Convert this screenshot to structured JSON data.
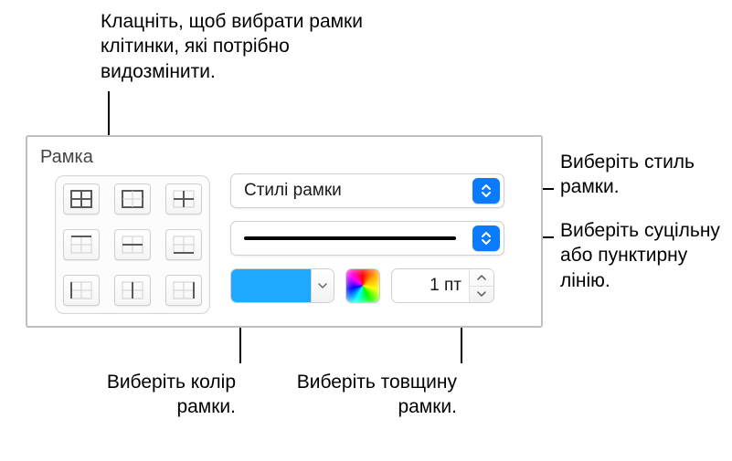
{
  "callouts": {
    "top": "Клацніть, щоб вибрати рамки клітинки, які потрібно видозмінити.",
    "style_right": "Виберіть стиль рамки.",
    "line_right": "Виберіть суцільну або пунктирну лінію.",
    "color_bottom": "Виберіть колір рамки.",
    "thickness_bottom": "Виберіть товщину рамки."
  },
  "panel": {
    "title": "Рамка"
  },
  "controls": {
    "style_popup_label": "Стилі рамки",
    "thickness_value": "1 пт",
    "border_color": "#1ea8ff"
  }
}
